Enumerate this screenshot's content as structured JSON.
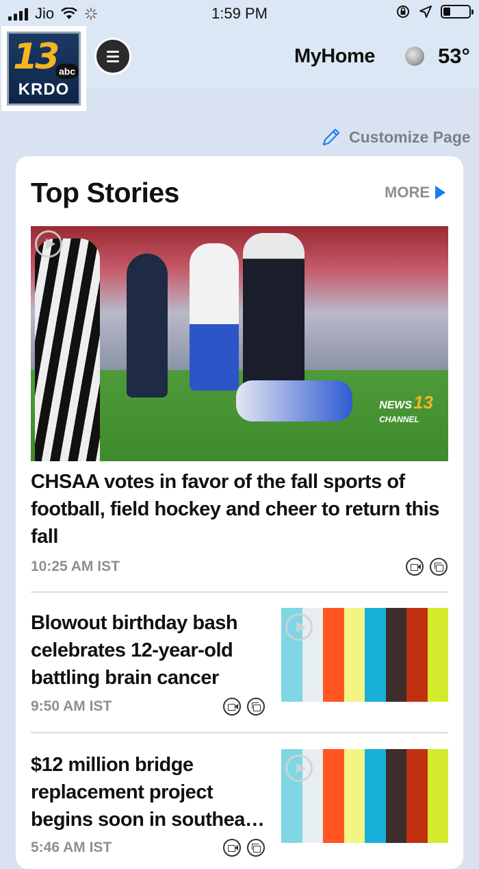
{
  "status_bar": {
    "carrier": "Jio",
    "time": "1:59 PM"
  },
  "header": {
    "logo": {
      "number": "13",
      "network": "abc",
      "callsign": "KRDO"
    },
    "title": "MyHome",
    "temperature": "53°"
  },
  "customize_label": "Customize Page",
  "section": {
    "title": "Top Stories",
    "more_label": "MORE",
    "accent_color": "#1a7df0"
  },
  "stories": [
    {
      "headline": "CHSAA votes in favor of the fall sports of football, field hockey and cheer to return this fall",
      "time": "10:25 AM IST",
      "has_video": true,
      "has_gallery": true,
      "image": {
        "watermark_top": "NEWS",
        "watermark_bottom": "CHANNEL",
        "watermark_num": "13"
      }
    },
    {
      "headline": "Blowout birthday bash celebrates 12-year-old battling brain cancer",
      "time": "9:50 AM IST",
      "has_video": true,
      "has_gallery": true
    },
    {
      "headline": "$12 million bridge replacement project begins soon in southea…",
      "time": "5:46 AM IST",
      "has_video": true,
      "has_gallery": true
    }
  ],
  "placeholder_colors": [
    "#7fd6e4",
    "#e6eef0",
    "#ff5622",
    "#f3f583",
    "#18b0d9",
    "#3d2d2b",
    "#c23012",
    "#d4ea2c"
  ]
}
